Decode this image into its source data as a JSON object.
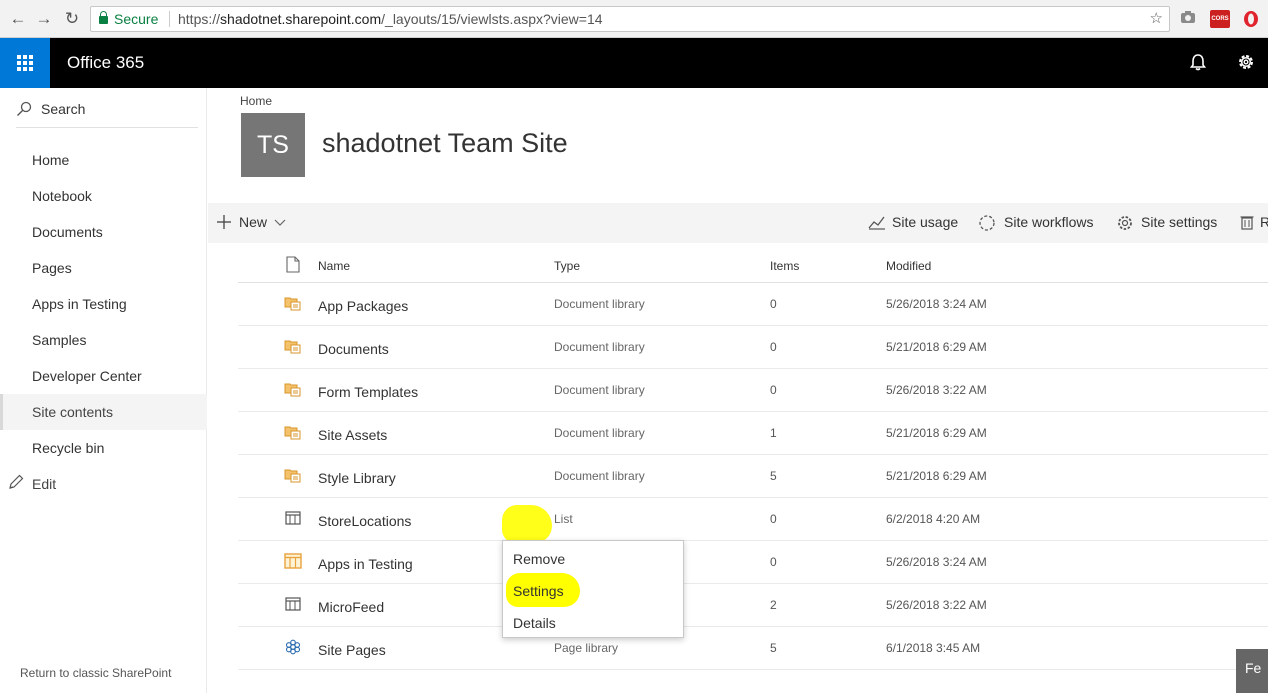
{
  "browser": {
    "secure_label": "Secure",
    "url_scheme": "https://",
    "url_host": "shadotnet.sharepoint.com",
    "url_path": "/_layouts/15/viewlsts.aspx?view=14",
    "ext_badge": "CORS"
  },
  "header": {
    "app_title": "Office 365"
  },
  "leftnav": {
    "search_label": "Search",
    "items": [
      {
        "label": "Home"
      },
      {
        "label": "Notebook"
      },
      {
        "label": "Documents"
      },
      {
        "label": "Pages"
      },
      {
        "label": "Apps in Testing"
      },
      {
        "label": "Samples"
      },
      {
        "label": "Developer Center"
      },
      {
        "label": "Site contents",
        "selected": true
      },
      {
        "label": "Recycle bin"
      }
    ],
    "edit_label": "Edit",
    "classic_link": "Return to classic SharePoint"
  },
  "site": {
    "breadcrumb": "Home",
    "logo_initials": "TS",
    "title": "shadotnet Team Site"
  },
  "commandbar": {
    "new_label": "New",
    "site_usage": "Site usage",
    "site_workflows": "Site workflows",
    "site_settings": "Site settings",
    "recycle_partial": "R"
  },
  "table": {
    "headers": {
      "name": "Name",
      "type": "Type",
      "items": "Items",
      "modified": "Modified"
    },
    "rows": [
      {
        "icon": "document-library-icon",
        "name": "App Packages",
        "type": "Document library",
        "items": "0",
        "modified": "5/26/2018 3:24 AM"
      },
      {
        "icon": "document-library-icon",
        "name": "Documents",
        "type": "Document library",
        "items": "0",
        "modified": "5/21/2018 6:29 AM"
      },
      {
        "icon": "document-library-icon",
        "name": "Form Templates",
        "type": "Document library",
        "items": "0",
        "modified": "5/26/2018 3:22 AM"
      },
      {
        "icon": "document-library-icon",
        "name": "Site Assets",
        "type": "Document library",
        "items": "1",
        "modified": "5/21/2018 6:29 AM"
      },
      {
        "icon": "document-library-icon",
        "name": "Style Library",
        "type": "Document library",
        "items": "5",
        "modified": "5/21/2018 6:29 AM"
      },
      {
        "icon": "list-icon",
        "name": "StoreLocations",
        "type": "List",
        "items": "0",
        "modified": "6/2/2018 4:20 AM"
      },
      {
        "icon": "app-list-icon",
        "name": "Apps in Testing",
        "type": "",
        "items": "0",
        "modified": "5/26/2018 3:24 AM"
      },
      {
        "icon": "list-icon",
        "name": "MicroFeed",
        "type": "",
        "items": "2",
        "modified": "5/26/2018 3:22 AM"
      },
      {
        "icon": "page-library-icon",
        "name": "Site Pages",
        "type": "Page library",
        "items": "5",
        "modified": "6/1/2018 3:45 AM"
      }
    ]
  },
  "context_menu": {
    "items": [
      "Remove",
      "Settings",
      "Details"
    ]
  },
  "feedback": {
    "label": "Fe"
  },
  "colors": {
    "brand_blue": "#0078d7",
    "header_black": "#000000",
    "highlight_yellow": "#ffff00",
    "library_orange": "#e8a33d"
  }
}
